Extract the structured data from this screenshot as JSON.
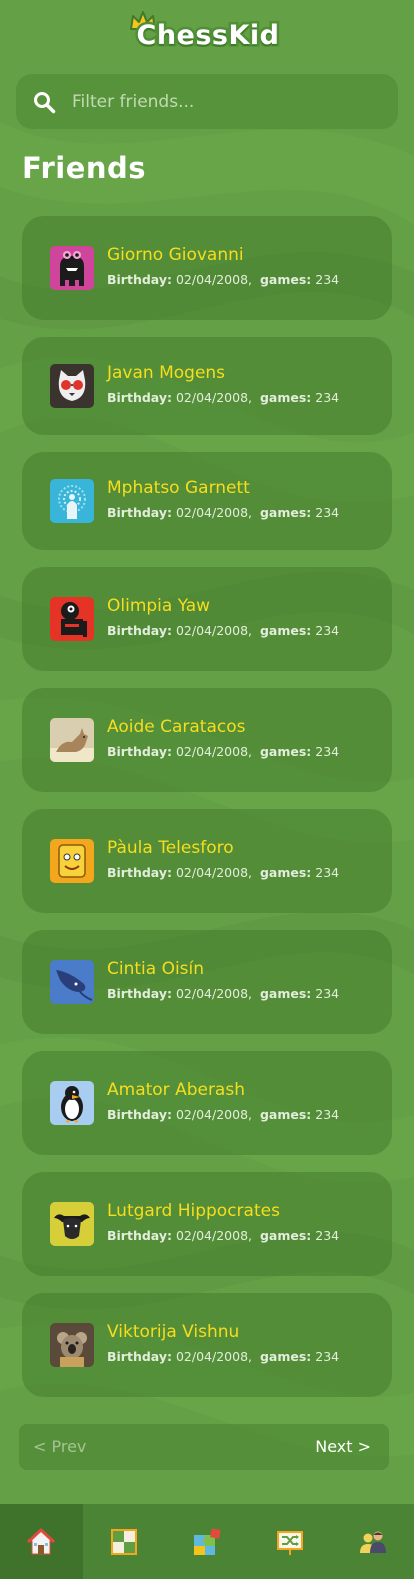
{
  "header": {
    "logo_text": "ChessKid"
  },
  "search": {
    "placeholder": "Filter friends..."
  },
  "page_title": "Friends",
  "friends": [
    {
      "name": "Giorno Giovanni",
      "birthday_label": "Birthday:",
      "birthday": "02/04/2008,",
      "games_label": "games:",
      "games": "234",
      "avatar": "pink-monster-icon"
    },
    {
      "name": "Javan Mogens",
      "birthday_label": "Birthday:",
      "birthday": "02/04/2008,",
      "games_label": "games:",
      "games": "234",
      "avatar": "cat-with-glasses-icon"
    },
    {
      "name": "Mphatso Garnett",
      "birthday_label": "Birthday:",
      "birthday": "02/04/2008,",
      "games_label": "games:",
      "games": "234",
      "avatar": "peacock-icon"
    },
    {
      "name": "Olimpia Yaw",
      "birthday_label": "Birthday:",
      "birthday": "02/04/2008,",
      "games_label": "games:",
      "games": "234",
      "avatar": "red-robot-icon"
    },
    {
      "name": "Aoide Caratacos",
      "birthday_label": "Birthday:",
      "birthday": "02/04/2008,",
      "games_label": "games:",
      "games": "234",
      "avatar": "lynx-photo-icon"
    },
    {
      "name": "Pàula Telesforo",
      "birthday_label": "Birthday:",
      "birthday": "02/04/2008,",
      "games_label": "games:",
      "games": "234",
      "avatar": "yellow-face-icon"
    },
    {
      "name": "Cintia Oisín",
      "birthday_label": "Birthday:",
      "birthday": "02/04/2008,",
      "games_label": "games:",
      "games": "234",
      "avatar": "stingray-icon"
    },
    {
      "name": "Amator Aberash",
      "birthday_label": "Birthday:",
      "birthday": "02/04/2008,",
      "games_label": "games:",
      "games": "234",
      "avatar": "penguin-icon"
    },
    {
      "name": "Lutgard Hippocrates",
      "birthday_label": "Birthday:",
      "birthday": "02/04/2008,",
      "games_label": "games:",
      "games": "234",
      "avatar": "buffalo-icon"
    },
    {
      "name": "Viktorija Vishnu",
      "birthday_label": "Birthday:",
      "birthday": "02/04/2008,",
      "games_label": "games:",
      "games": "234",
      "avatar": "koala-photo-icon"
    }
  ],
  "pagination": {
    "prev_label": "< Prev",
    "next_label": "Next >"
  },
  "bottom_nav": [
    {
      "icon": "home-icon",
      "active": true
    },
    {
      "icon": "chessboard-icon",
      "active": false
    },
    {
      "icon": "puzzle-icon",
      "active": false
    },
    {
      "icon": "shuffle-board-icon",
      "active": false
    },
    {
      "icon": "people-icon",
      "active": false
    }
  ],
  "colors": {
    "background": "#64a146",
    "name_text": "#f6dd1e",
    "nav_bar": "#4c8436"
  }
}
